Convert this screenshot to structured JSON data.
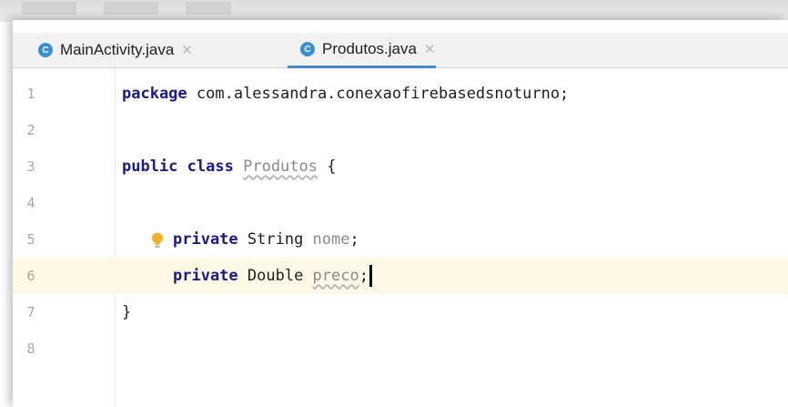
{
  "tabs": [
    {
      "label": "MainActivity.java",
      "icon": "C",
      "active": false
    },
    {
      "label": "Produtos.java",
      "icon": "C",
      "active": true
    }
  ],
  "colors": {
    "accent": "#4a86c8",
    "class_icon": "#3a8fd6",
    "keyword": "#1a1a8c",
    "current_line": "#fcfae6"
  },
  "editor": {
    "line_numbers": [
      "1",
      "2",
      "3",
      "4",
      "5",
      "6",
      "7",
      "8"
    ],
    "code": {
      "l1_keyword": "package",
      "l1_rest": " com.alessandra.conexaofirebasedsnoturno;",
      "l3_kw1": "public",
      "l3_kw2": "class",
      "l3_name": "Produtos",
      "l3_brace": " {",
      "l5_kw": "private",
      "l5_type": " String ",
      "l5_name": "nome",
      "l5_semi": ";",
      "l6_kw": "private",
      "l6_type": " Double ",
      "l6_name": "preco",
      "l6_semi": ";",
      "l7_brace": "}"
    },
    "current_line": "6"
  }
}
